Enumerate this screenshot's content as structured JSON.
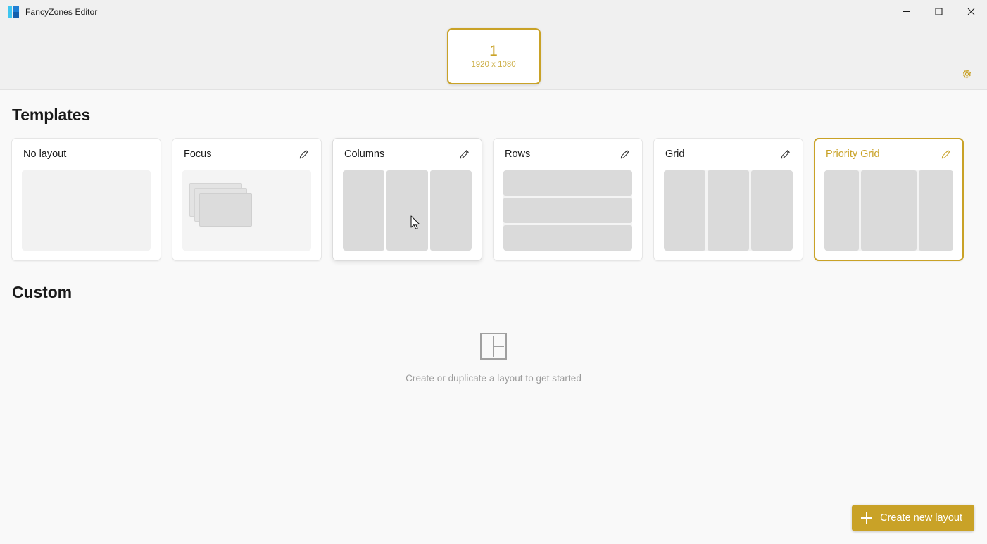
{
  "window": {
    "title": "FancyZones Editor",
    "app_icon": "fancyzones-icon",
    "controls": {
      "minimize": "minimize-icon",
      "maximize": "maximize-icon",
      "close": "close-icon"
    }
  },
  "header": {
    "monitor": {
      "index": "1",
      "resolution": "1920 x 1080",
      "accent": "#c9a227",
      "selected": true
    },
    "settings_icon": "gear-icon"
  },
  "templates": {
    "heading": "Templates",
    "edit_icon": "pencil-icon",
    "cards": [
      {
        "label": "No layout",
        "preview": "empty",
        "editable": false,
        "selected": false,
        "hovered": false
      },
      {
        "label": "Focus",
        "preview": "cascade",
        "editable": true,
        "selected": false,
        "hovered": false
      },
      {
        "label": "Columns",
        "preview": "columns",
        "editable": true,
        "selected": false,
        "hovered": true
      },
      {
        "label": "Rows",
        "preview": "rows",
        "editable": true,
        "selected": false,
        "hovered": false
      },
      {
        "label": "Grid",
        "preview": "columns",
        "editable": true,
        "selected": false,
        "hovered": false
      },
      {
        "label": "Priority Grid",
        "preview": "priority",
        "editable": true,
        "selected": true,
        "hovered": false
      }
    ]
  },
  "custom": {
    "heading": "Custom",
    "empty_icon": "layout-zones-icon",
    "empty_text": "Create or duplicate a layout to get started"
  },
  "actions": {
    "create_new_layout": "Create new layout",
    "create_icon": "plus-icon"
  },
  "colors": {
    "accent": "#c9a227",
    "header_bg": "#f0f0f0",
    "body_bg": "#f9f9f9",
    "zone_fill": "#dadada"
  }
}
